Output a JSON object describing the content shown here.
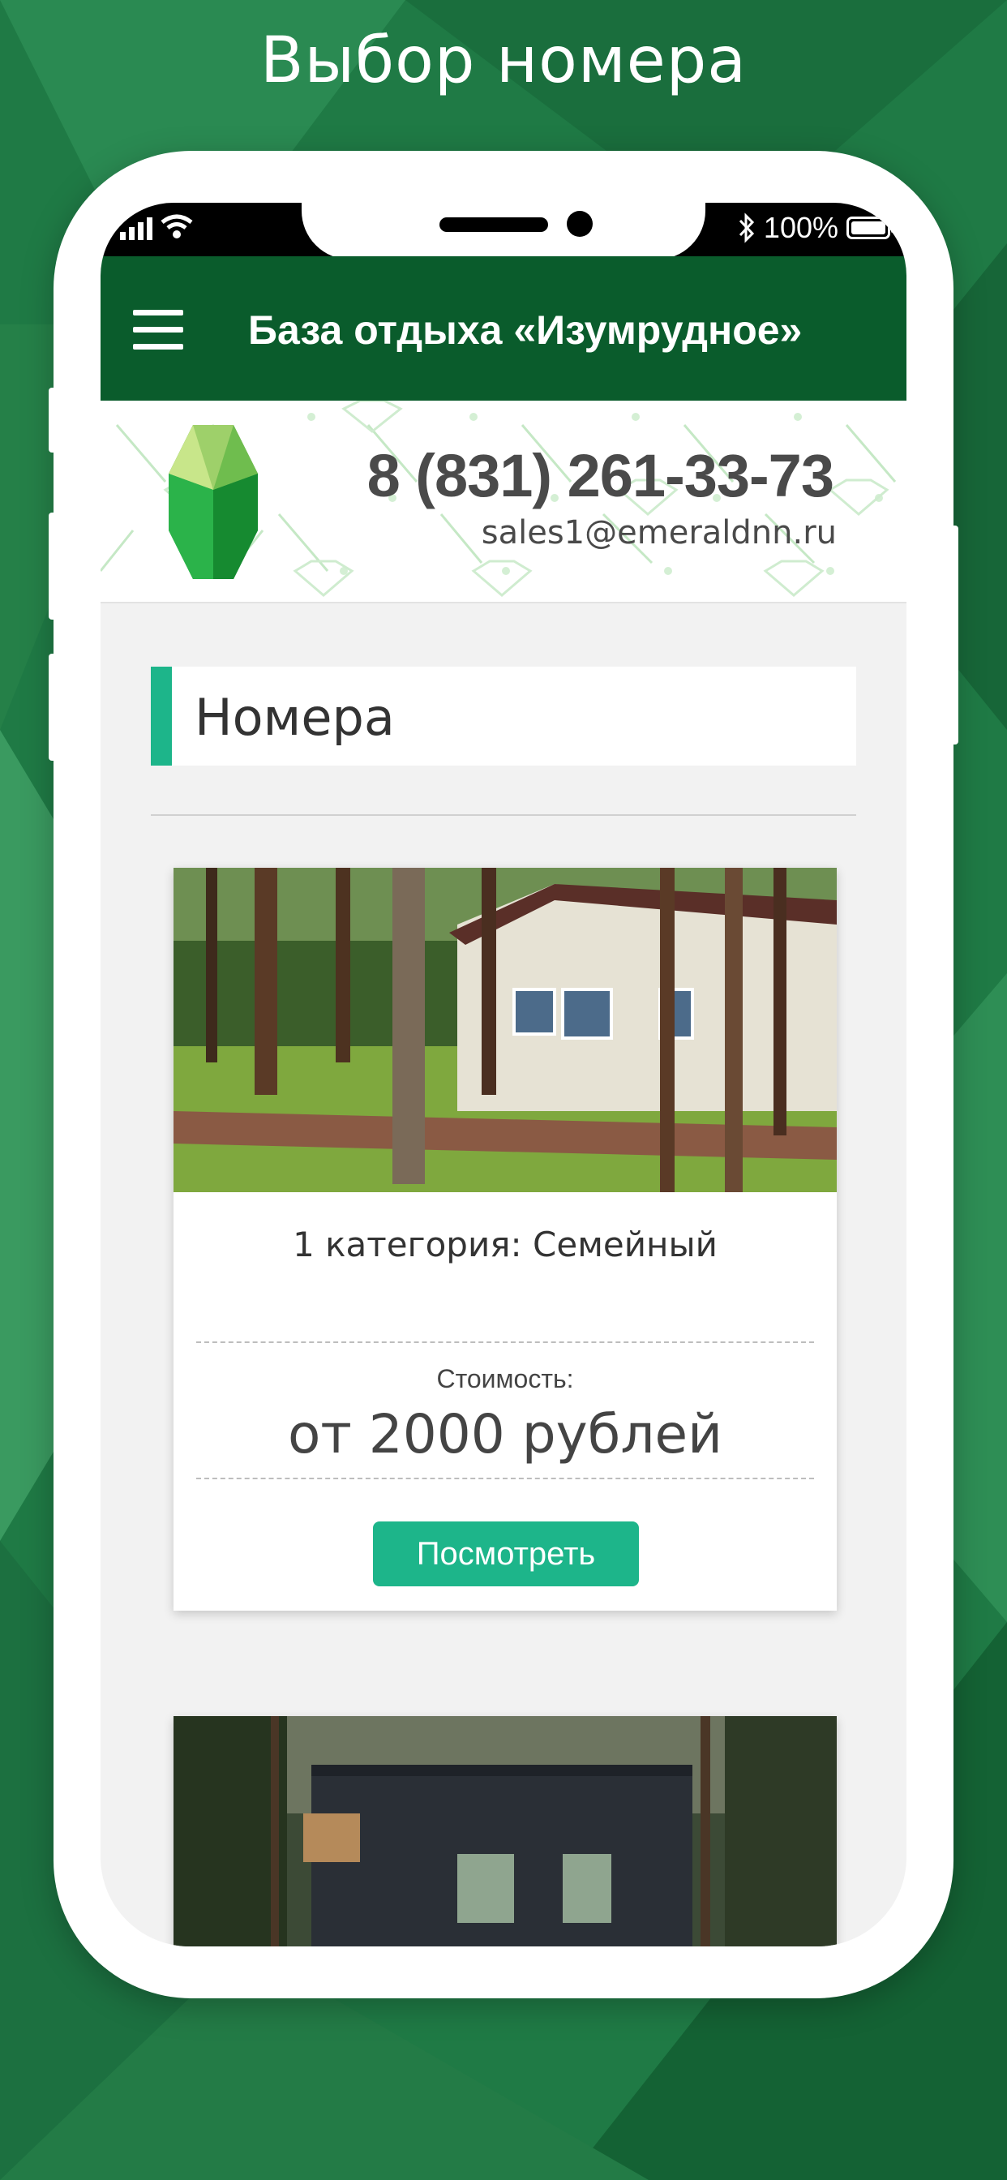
{
  "promo": {
    "title": "Выбор номера"
  },
  "status_bar": {
    "battery": "100%",
    "icons": [
      "signal-icon",
      "wifi-icon",
      "bluetooth-icon",
      "battery-icon"
    ]
  },
  "app_bar": {
    "title": "База отдыха «Изумрудное»",
    "menu_icon": "hamburger-icon"
  },
  "header": {
    "phone": "8 (831) 261-33-73",
    "email": "sales1@emeraldnn.ru"
  },
  "section": {
    "title": "Номера"
  },
  "rooms": [
    {
      "name": "1 категория: Семейный",
      "price_label": "Стоимость:",
      "price": "от 2000 рублей",
      "button": "Посмотреть"
    }
  ],
  "colors": {
    "app_bar": "#0a5c2c",
    "accent": "#1db58a",
    "background": "#1f7a45"
  }
}
